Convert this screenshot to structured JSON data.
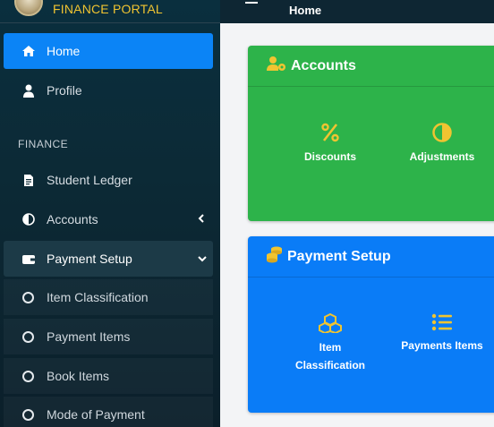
{
  "brand": {
    "title": "FINANCE PORTAL"
  },
  "topbar": {
    "title": "Home"
  },
  "sidebar": {
    "items": [
      {
        "label": "Home",
        "icon": "home-icon",
        "active": true
      },
      {
        "label": "Profile",
        "icon": "user-icon"
      }
    ],
    "section": "FINANCE",
    "finance_items": [
      {
        "label": "Student Ledger",
        "icon": "file-icon"
      },
      {
        "label": "Accounts",
        "icon": "half-circle-icon",
        "arrow": "chevron-left-icon"
      },
      {
        "label": "Payment Setup",
        "icon": "wallet-icon",
        "arrow": "chevron-down-icon",
        "open": true
      }
    ],
    "payment_setup_sub": [
      {
        "label": "Item Classification"
      },
      {
        "label": "Payment Items"
      },
      {
        "label": "Book Items"
      },
      {
        "label": "Mode of Payment"
      }
    ]
  },
  "cards": {
    "accounts": {
      "title": "Accounts",
      "icon": "user-cog-icon",
      "color": "#2db34a",
      "tiles": [
        {
          "label": "Discounts",
          "icon": "percent-icon"
        },
        {
          "label": "Adjustments",
          "icon": "adjust-icon"
        }
      ]
    },
    "payment_setup": {
      "title": "Payment Setup",
      "icon": "coins-icon",
      "color": "#0a7cf7",
      "tiles": [
        {
          "label_line1": "Item",
          "label_line2": "Classification",
          "icon": "cubes-icon"
        },
        {
          "label": "Payments Items",
          "icon": "list-icon"
        }
      ]
    }
  },
  "colors": {
    "accent_yellow": "#f0c431",
    "active_blue": "#0b84f6",
    "sidebar_dark": "#0a2f3e"
  }
}
